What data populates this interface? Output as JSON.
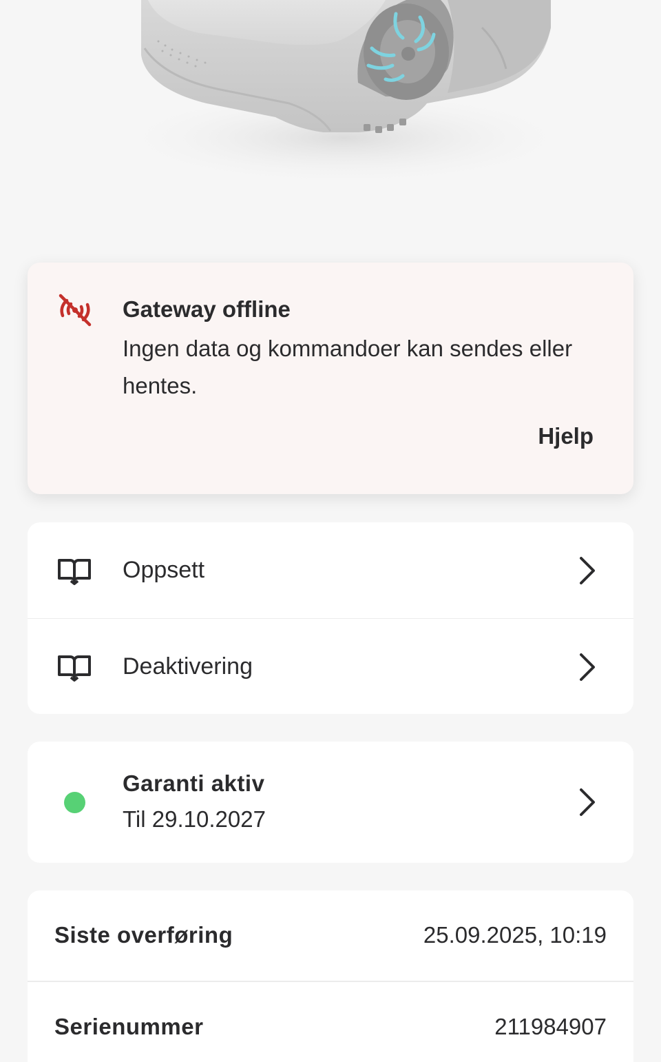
{
  "hero": {
    "image": "robotic-lawn-mower"
  },
  "alert": {
    "icon": "signal-off-icon",
    "icon_color": "#c4302b",
    "title": "Gateway offline",
    "message": "Ingen data og kommandoer kan sendes eller hentes.",
    "help_label": "Hjelp",
    "background": "#fbf5f4"
  },
  "menu": {
    "items": [
      {
        "label": "Oppsett",
        "icon": "book-icon"
      },
      {
        "label": "Deaktivering",
        "icon": "book-icon"
      }
    ]
  },
  "warranty": {
    "title": "Garanti aktiv",
    "subtitle": "Til 29.10.2027",
    "status_color": "#57d175"
  },
  "info": {
    "rows": [
      {
        "label": "Siste overføring",
        "value": "25.09.2025, 10:19"
      },
      {
        "label": "Serienummer",
        "value": "211984907"
      }
    ]
  }
}
